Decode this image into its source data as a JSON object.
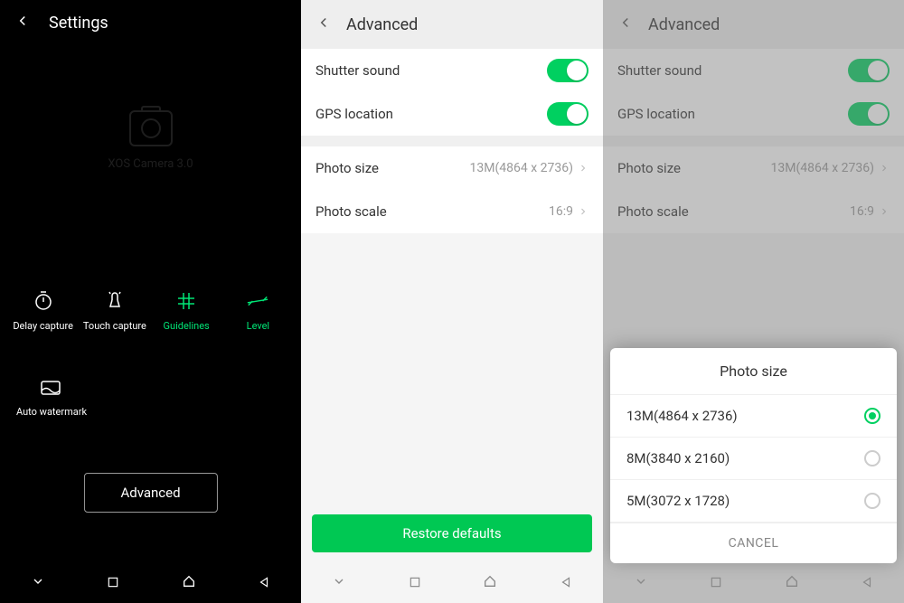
{
  "panel1": {
    "header_title": "Settings",
    "cam_label": "XOS Camera 3.0",
    "options": {
      "delay_capture": "Delay capture",
      "touch_capture": "Touch capture",
      "guidelines": "Guidelines",
      "level": "Level",
      "auto_watermark": "Auto watermark"
    },
    "advanced_btn": "Advanced"
  },
  "panel2": {
    "header_title": "Advanced",
    "shutter_sound": "Shutter sound",
    "gps_location": "GPS location",
    "photo_size_label": "Photo size",
    "photo_size_value": "13M(4864 x 2736)",
    "photo_scale_label": "Photo scale",
    "photo_scale_value": "16:9",
    "restore_btn": "Restore defaults"
  },
  "panel3": {
    "header_title": "Advanced",
    "shutter_sound": "Shutter sound",
    "gps_location": "GPS location",
    "photo_size_label": "Photo size",
    "photo_size_value": "13M(4864 x 2736)",
    "photo_scale_label": "Photo scale",
    "photo_scale_value": "16:9",
    "sheet": {
      "title": "Photo size",
      "opt1": "13M(4864 x 2736)",
      "opt2": "8M(3840 x 2160)",
      "opt3": "5M(3072 x 1728)",
      "cancel": "CANCEL"
    }
  }
}
